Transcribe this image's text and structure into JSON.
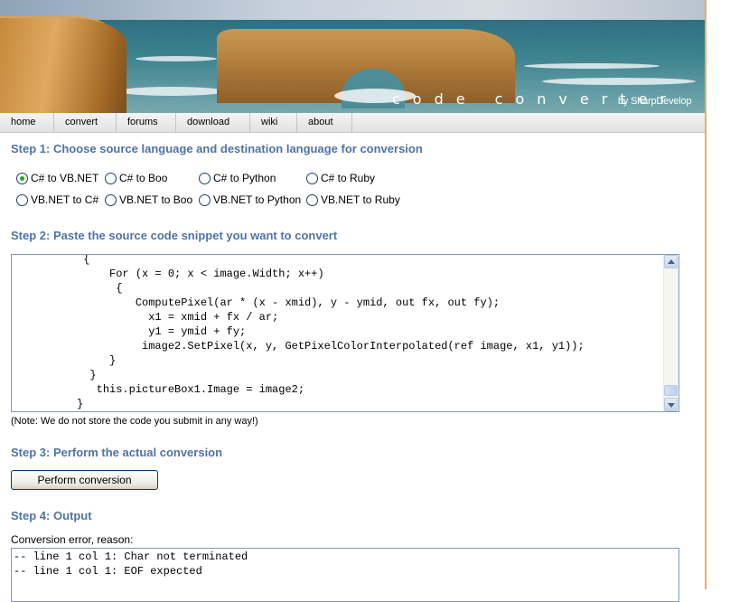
{
  "banner": {
    "title": "code converter",
    "subtitle": "by SharpDevelop"
  },
  "nav": {
    "items": [
      "home",
      "convert",
      "forums",
      "download",
      "wiki",
      "about"
    ]
  },
  "step1": {
    "heading": "Step 1: Choose source language and destination language for conversion",
    "options": [
      {
        "label": "C# to VB.NET",
        "selected": true
      },
      {
        "label": "C# to Boo",
        "selected": false
      },
      {
        "label": "C# to Python",
        "selected": false
      },
      {
        "label": "C# to Ruby",
        "selected": false
      },
      {
        "label": "VB.NET to C#",
        "selected": false
      },
      {
        "label": "VB.NET to Boo",
        "selected": false
      },
      {
        "label": "VB.NET to Python",
        "selected": false
      },
      {
        "label": "VB.NET to Ruby",
        "selected": false
      }
    ]
  },
  "step2": {
    "heading": "Step 2: Paste the source code snippet you want to convert",
    "code_lines": [
      "           {",
      "               For (x = 0; x < image.Width; x++)",
      "                {",
      "                   ComputePixel(ar * (x - xmid), y - ymid, out fx, out fy);",
      "                     x1 = xmid + fx / ar;",
      "                     y1 = ymid + fy;",
      "                    image2.SetPixel(x, y, GetPixelColorInterpolated(ref image, x1, y1));",
      "               }",
      "            }",
      "             this.pictureBox1.Image = image2;",
      "          }"
    ],
    "note": "(Note: We do not store the code you submit in any way!)"
  },
  "step3": {
    "heading": "Step 3: Perform the actual conversion",
    "button_label": "Perform conversion"
  },
  "step4": {
    "heading": "Step 4: Output",
    "label": "Conversion error, reason:",
    "output_lines": [
      "-- line 1 col 1: Char not terminated",
      "-- line 1 col 1: EOF expected"
    ]
  },
  "colors": {
    "heading": "#4f74a7",
    "accent_rule": "#e8b25a",
    "radio_selected": "#21a121"
  }
}
